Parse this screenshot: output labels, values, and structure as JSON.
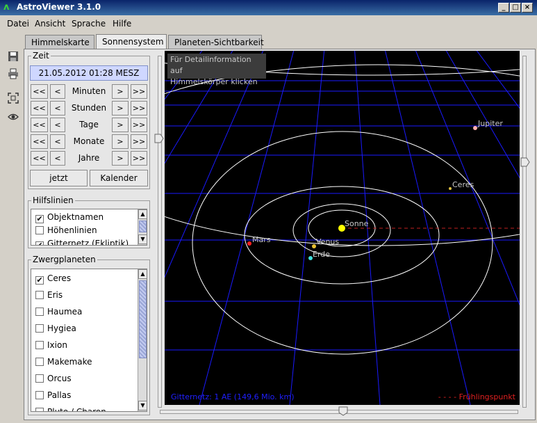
{
  "window": {
    "title": "AstroViewer 3.1.0",
    "icon": "astroviewer-logo-icon"
  },
  "menu": [
    "Datei",
    "Ansicht",
    "Sprache",
    "Hilfe"
  ],
  "tabs": [
    {
      "label": "Himmelskarte",
      "active": false
    },
    {
      "label": "Sonnensystem",
      "active": true
    },
    {
      "label": "Planeten-Sichtbarkeit",
      "active": false
    }
  ],
  "toolbar": [
    "save-icon",
    "print-icon",
    "fit-view-icon",
    "eye-icon"
  ],
  "zeit": {
    "title": "Zeit",
    "datetime": "21.05.2012 01:28 MESZ",
    "rows": [
      "Minuten",
      "Stunden",
      "Tage",
      "Monate",
      "Jahre"
    ],
    "btn_back_fast": "<<",
    "btn_back": "<",
    "btn_fwd": ">",
    "btn_fwd_fast": ">>",
    "now": "jetzt",
    "calendar": "Kalender"
  },
  "hilfslinien": {
    "title": "Hilfslinien",
    "items": [
      {
        "label": "Objektnamen",
        "checked": true
      },
      {
        "label": "Höhenlinien",
        "checked": false
      },
      {
        "label": "Gitternetz (Ekliptik)",
        "checked": true
      }
    ]
  },
  "zwergplaneten": {
    "title": "Zwergplaneten",
    "items": [
      {
        "label": "Ceres",
        "checked": true
      },
      {
        "label": "Eris",
        "checked": false
      },
      {
        "label": "Haumea",
        "checked": false
      },
      {
        "label": "Hygiea",
        "checked": false
      },
      {
        "label": "Ixion",
        "checked": false
      },
      {
        "label": "Makemake",
        "checked": false
      },
      {
        "label": "Orcus",
        "checked": false
      },
      {
        "label": "Pallas",
        "checked": false
      },
      {
        "label": "Pluto / Charon",
        "checked": false
      }
    ]
  },
  "view": {
    "info": [
      "Für Detailinformation auf",
      "Himmelskörper klicken"
    ],
    "grid_legend": "Gitternetz: 1 AE (149,6 Mio. km)",
    "spring_legend": "- - - - Frühlingspunkt",
    "bodies": [
      {
        "name": "Sonne",
        "color": "#ffff00"
      },
      {
        "name": "Venus",
        "color": "#e8c030"
      },
      {
        "name": "Erde",
        "color": "#40e0e0"
      },
      {
        "name": "Mars",
        "color": "#ff2020"
      },
      {
        "name": "Ceres",
        "color": "#e0c040"
      },
      {
        "name": "Jupiter",
        "color": "#ffb0b0"
      }
    ],
    "colors": {
      "grid": "#1a1aff",
      "orbit": "#ffffff",
      "label": "#c8c8c8",
      "spring_line": "#c02020"
    }
  }
}
